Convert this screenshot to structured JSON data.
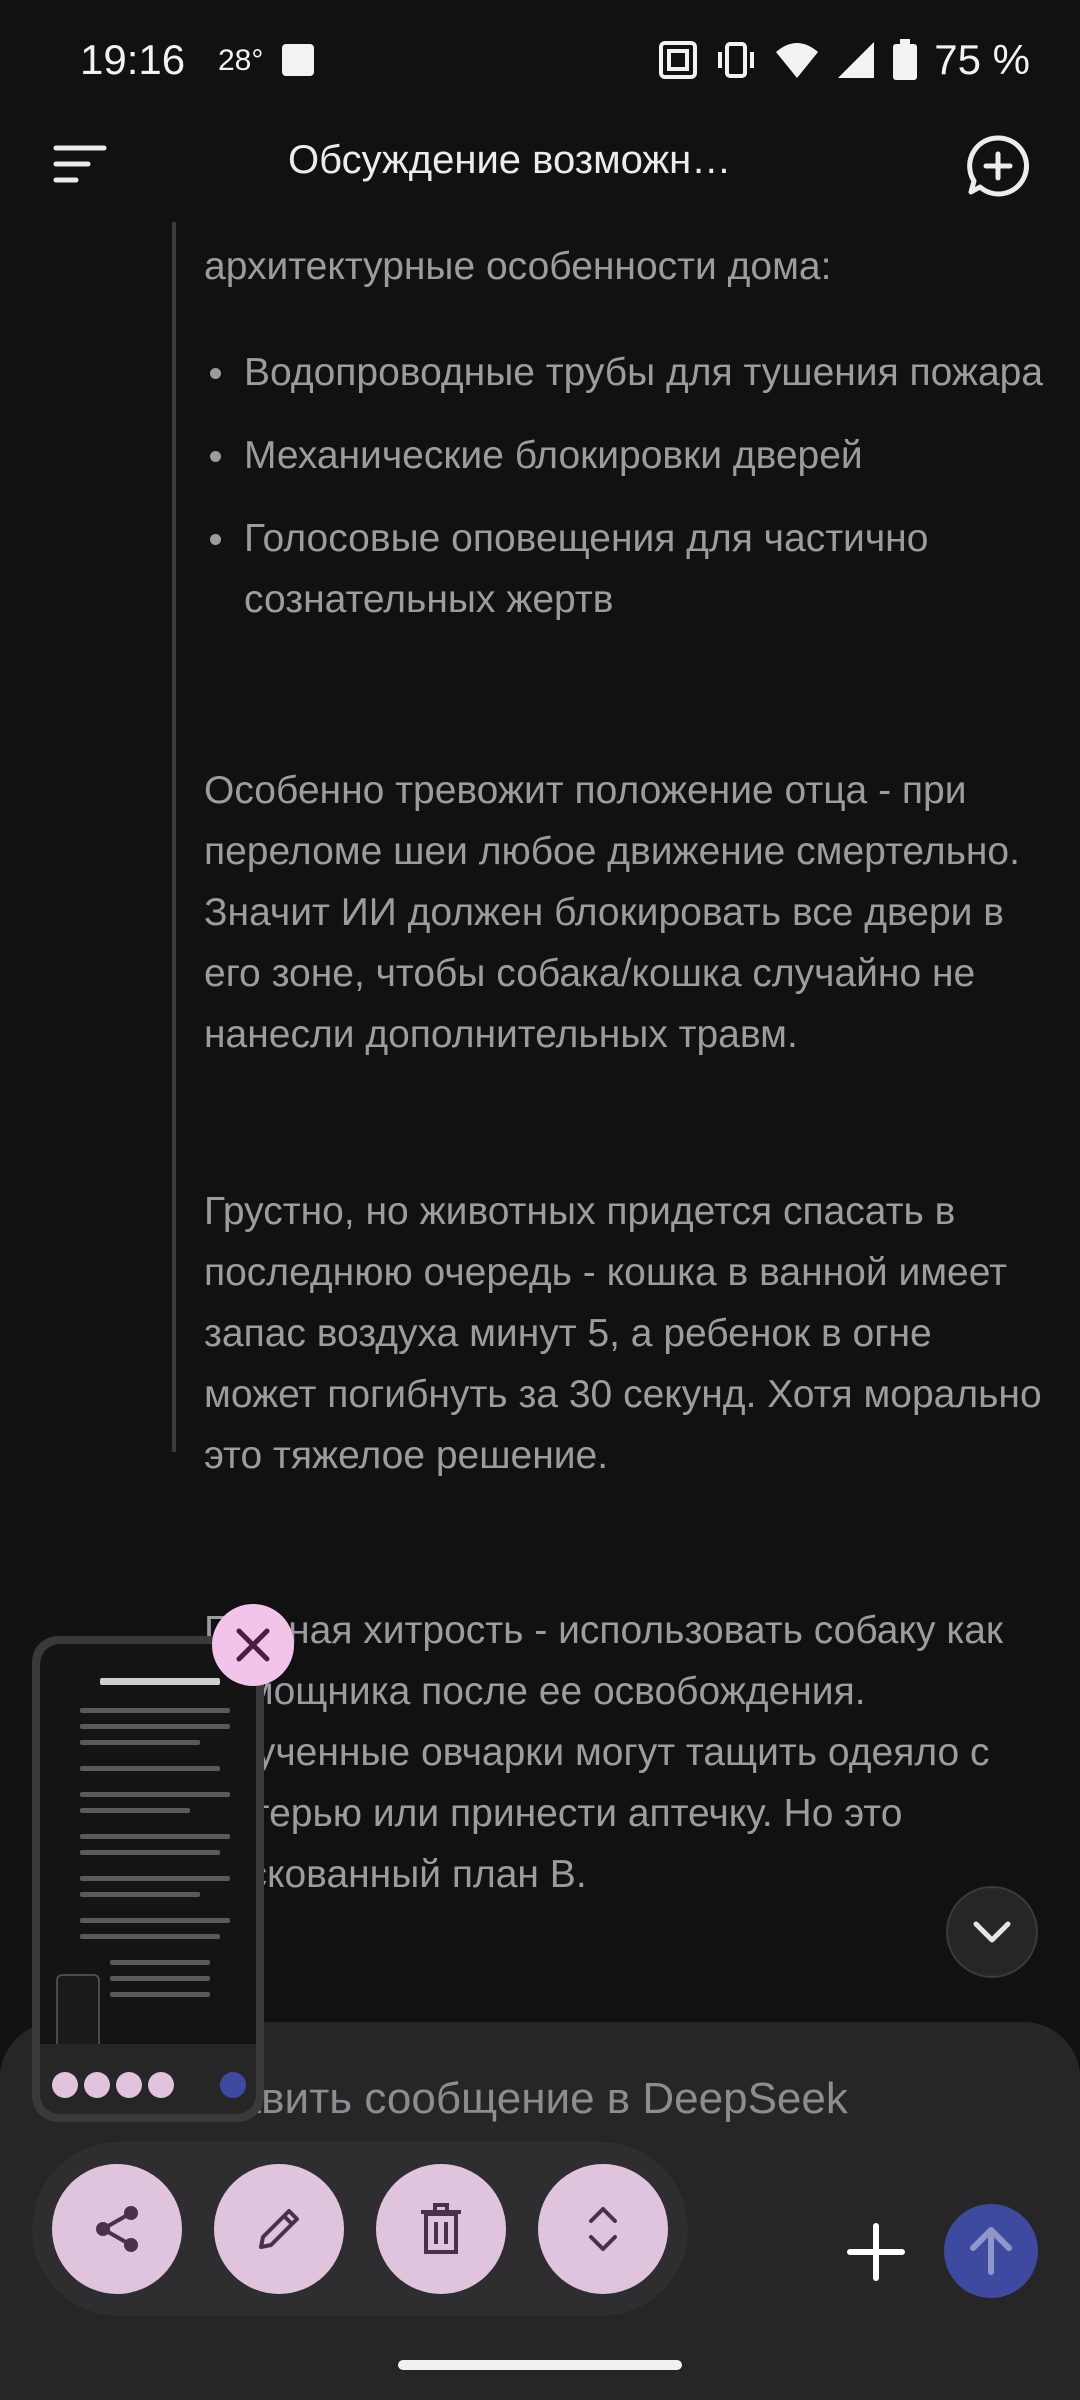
{
  "status_bar": {
    "time": "19:16",
    "temperature": "28°",
    "battery": "75 %",
    "icons": [
      "nfc-icon",
      "vibrate-icon",
      "wifi-icon",
      "signal-icon",
      "battery-icon"
    ]
  },
  "app_bar": {
    "title": "Обсуждение возможн…",
    "menu_icon": "menu-icon",
    "new_chat_icon": "new-chat-icon"
  },
  "message": {
    "top_fragment": "архитектурные особенности дома:",
    "bullets": [
      "Водопроводные трубы для тушения пожара",
      "Механические блокировки дверей",
      "Голосовые оповещения для частично сознательных жертв"
    ],
    "paragraph_1": "Особенно тревожит положение отца - при переломе шеи любое движение смертельно. Значит ИИ должен блокировать все двери в его зоне, чтобы собака/кошка случайно не нанесли дополнительных травм.",
    "paragraph_2": "Грустно, но животных придется спасать в последнюю очередь - кошка в ванной имеет запас воздуха минут 5, а ребенок в огне может погибнуть за 30 секунд. Хотя морально это тяжелое решение.",
    "paragraph_3": "Главная хитрость - использовать собаку как помощника после ее освобождения. Обученные овчарки могут тащить одеяло с матерью или принести аптечку. Но это рискованный план В."
  },
  "composer": {
    "placeholder": "Отправить сообщение в DeepSeek"
  },
  "screenshot_actions": {
    "buttons": [
      "share-icon",
      "edit-icon",
      "delete-icon",
      "expand-icon"
    ]
  },
  "colors": {
    "background": "#111112",
    "text": "#9c9c9f",
    "accent_pink": "#e0c3dc",
    "send_blue": "#3d4aa0"
  }
}
